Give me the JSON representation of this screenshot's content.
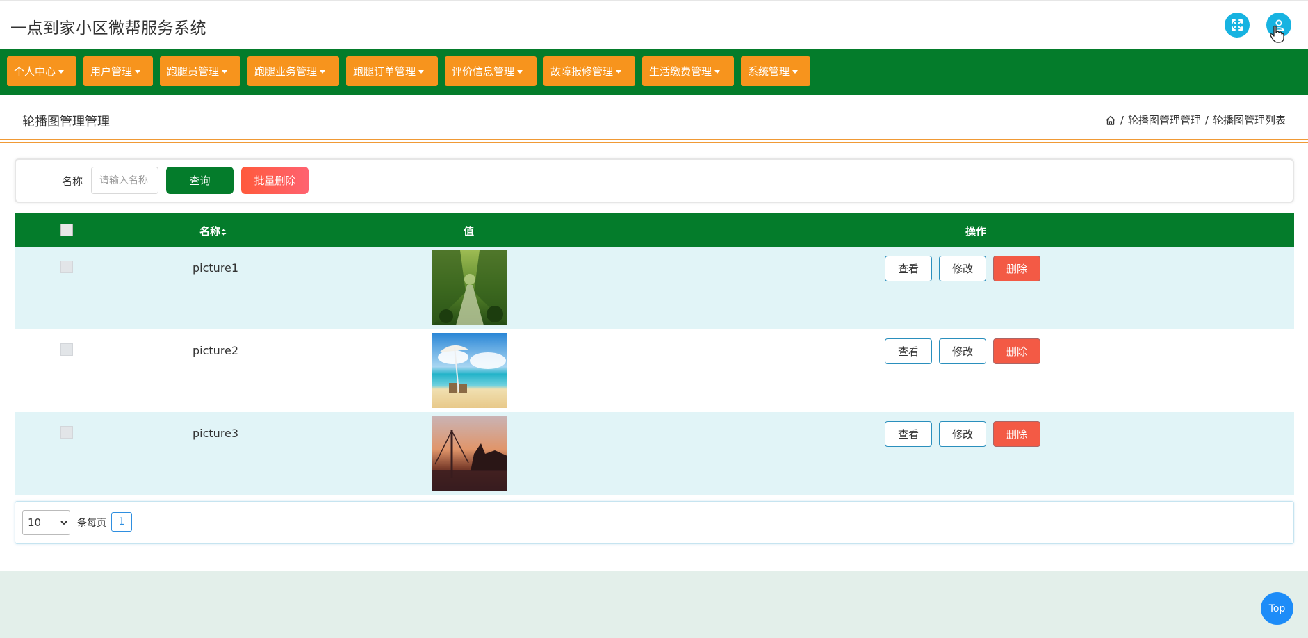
{
  "header": {
    "app_title": "一点到家小区微帮服务系统",
    "icons": [
      "fullscreen-icon",
      "user-icon"
    ]
  },
  "nav": {
    "items": [
      {
        "label": "个人中心"
      },
      {
        "label": "用户管理"
      },
      {
        "label": "跑腿员管理"
      },
      {
        "label": "跑腿业务管理"
      },
      {
        "label": "跑腿订单管理"
      },
      {
        "label": "评价信息管理"
      },
      {
        "label": "故障报修管理"
      },
      {
        "label": "生活缴费管理"
      },
      {
        "label": "系统管理"
      }
    ]
  },
  "page": {
    "title": "轮播图管理管理",
    "breadcrumb": [
      "轮播图管理管理",
      "轮播图管理列表"
    ],
    "separator": "/"
  },
  "search": {
    "label": "名称",
    "placeholder": "请输入名称",
    "query_label": "查询",
    "batch_delete_label": "批量删除"
  },
  "table": {
    "columns": {
      "name": "名称",
      "value": "值",
      "actions": "操作"
    },
    "rows": [
      {
        "name": "picture1"
      },
      {
        "name": "picture2"
      },
      {
        "name": "picture3"
      }
    ],
    "actions": {
      "view": "查看",
      "edit": "修改",
      "delete": "删除"
    }
  },
  "pagination": {
    "page_size": "10",
    "page_size_options": [
      "10"
    ],
    "per_page_label": "条每页",
    "current_page": "1"
  },
  "back_to_top": "Top",
  "colors": {
    "nav_bg": "#047c2b",
    "nav_item": "#f7941d",
    "row_stripe": "#e1f4f7",
    "delete_btn": "#f35a45",
    "accent_blue": "#17b3e1"
  }
}
